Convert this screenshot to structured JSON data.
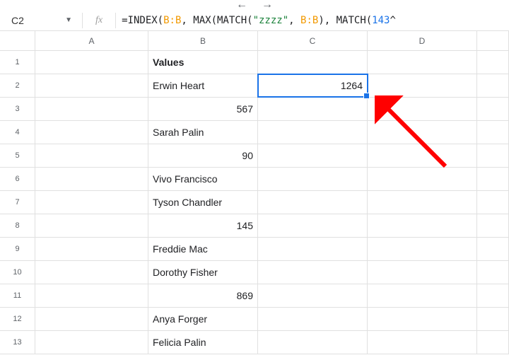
{
  "cellRef": "C2",
  "formula": {
    "prefix": "=INDEX(",
    "ref1": "B:B",
    "mid1": ", MAX(MATCH(",
    "str": "\"zzzz\"",
    "mid2": ", ",
    "ref2": "B:B",
    "mid3": "), MATCH(",
    "num": "143",
    "suffix": "^"
  },
  "columns": [
    "A",
    "B",
    "C",
    "D",
    ""
  ],
  "rows": [
    "1",
    "2",
    "3",
    "4",
    "5",
    "6",
    "7",
    "8",
    "9",
    "10",
    "11",
    "12",
    "13"
  ],
  "cells": {
    "B1": {
      "value": "Values",
      "bold": true
    },
    "B2": {
      "value": "Erwin Heart"
    },
    "C2": {
      "value": "1264",
      "align": "right",
      "selected": true
    },
    "B3": {
      "value": "567",
      "align": "right"
    },
    "B4": {
      "value": "Sarah Palin"
    },
    "B5": {
      "value": "90",
      "align": "right"
    },
    "B6": {
      "value": "Vivo Francisco"
    },
    "B7": {
      "value": "Tyson Chandler"
    },
    "B8": {
      "value": "145",
      "align": "right"
    },
    "B9": {
      "value": "Freddie Mac"
    },
    "B10": {
      "value": "Dorothy Fisher"
    },
    "B11": {
      "value": "869",
      "align": "right"
    },
    "B12": {
      "value": "Anya Forger"
    },
    "B13": {
      "value": "Felicia Palin"
    }
  },
  "chart_data": {
    "type": "table",
    "columns": [
      "Values"
    ],
    "rows": [
      [
        "Erwin Heart"
      ],
      [
        567
      ],
      [
        "Sarah Palin"
      ],
      [
        90
      ],
      [
        "Vivo Francisco"
      ],
      [
        "Tyson Chandler"
      ],
      [
        145
      ],
      [
        "Freddie Mac"
      ],
      [
        "Dorothy Fisher"
      ],
      [
        869
      ],
      [
        "Anya Forger"
      ],
      [
        "Felicia Palin"
      ]
    ],
    "formula_result": {
      "cell": "C2",
      "value": 1264
    }
  }
}
